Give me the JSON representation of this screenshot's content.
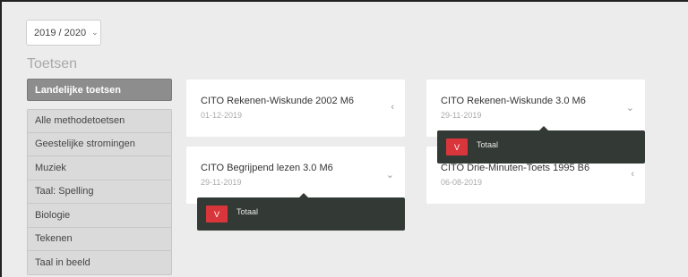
{
  "year_select": {
    "value": "2019 / 2020",
    "icon": "chevron-down-icon"
  },
  "page_title": "Toetsen",
  "sidebar": {
    "primary": "Landelijke toetsen",
    "items": [
      "Alle methodetoetsen",
      "Geestelijke stromingen",
      "Muziek",
      "Taal: Spelling",
      "Biologie",
      "Tekenen",
      "Taal in beeld"
    ]
  },
  "cards": [
    {
      "title": "CITO Rekenen-Wiskunde 2002 M6",
      "date": "01-12-2019",
      "icon": "chevron-left-icon",
      "chev": "‹"
    },
    {
      "title": "CITO Rekenen-Wiskunde 3.0 M6",
      "date": "29-11-2019",
      "icon": "chevron-down-icon",
      "chev": "⌄"
    },
    {
      "title": "CITO Begrijpend lezen 3.0 M6",
      "date": "29-11-2019",
      "icon": "chevron-down-icon",
      "chev": "⌄"
    },
    {
      "title": "CITO Drie-Minuten-Toets 1995 B6",
      "date": "06-08-2019",
      "icon": "chevron-left-icon",
      "chev": "‹"
    }
  ],
  "tooltips": [
    {
      "badge": "V",
      "label": "Totaal"
    },
    {
      "badge": "V",
      "label": "Totaal"
    }
  ],
  "colors": {
    "badge": "#d9363b",
    "tooltip_bg": "#333a36",
    "sidebar_active": "#8d8d8d"
  }
}
